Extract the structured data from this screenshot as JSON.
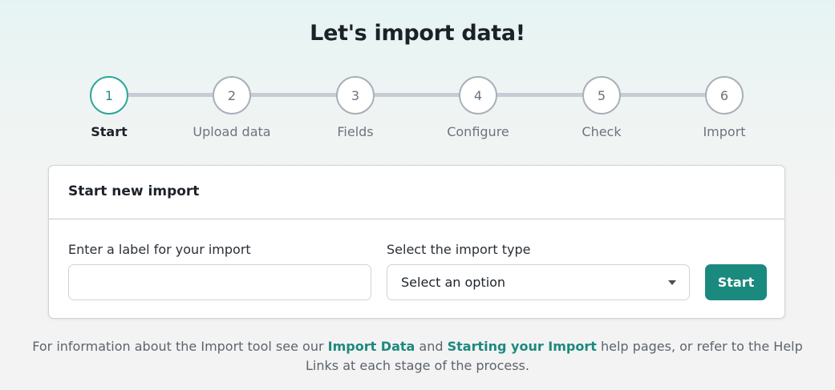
{
  "page": {
    "title": "Let's import data!"
  },
  "steps": [
    {
      "number": "1",
      "label": "Start",
      "active": true
    },
    {
      "number": "2",
      "label": "Upload data",
      "active": false
    },
    {
      "number": "3",
      "label": "Fields",
      "active": false
    },
    {
      "number": "4",
      "label": "Configure",
      "active": false
    },
    {
      "number": "5",
      "label": "Check",
      "active": false
    },
    {
      "number": "6",
      "label": "Import",
      "active": false
    }
  ],
  "card": {
    "title": "Start new import",
    "label_field": {
      "label": "Enter a label for your import",
      "value": "",
      "placeholder": ""
    },
    "type_field": {
      "label": "Select the import type",
      "selected": "Select an option"
    },
    "start_button": "Start"
  },
  "footer": {
    "text_before": "For information about the Import tool see our ",
    "link1": "Import Data",
    "text_middle": " and ",
    "link2": "Starting your Import",
    "text_after": " help pages, or refer to the Help Links at each stage of the process."
  },
  "colors": {
    "accent": "#1b8a7e",
    "active_step_border": "#2ca79a",
    "inactive_step_border": "#a9b0b9"
  }
}
